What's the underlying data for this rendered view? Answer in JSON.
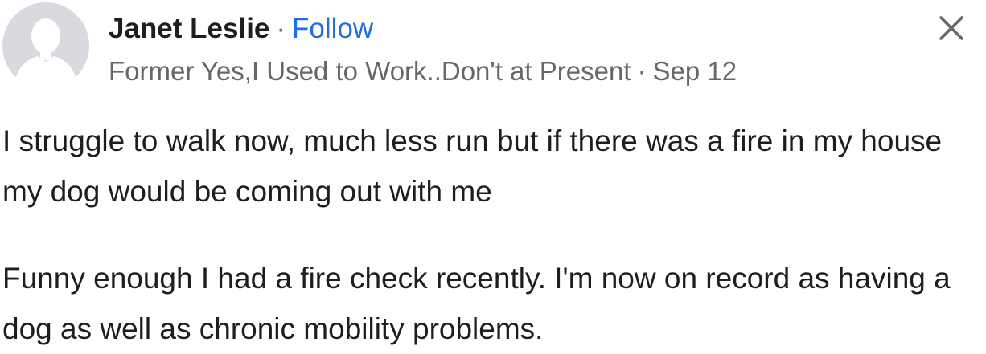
{
  "post": {
    "author": {
      "name": "Janet Leslie",
      "follow_label": "Follow",
      "name_separator": "·",
      "subtitle": "Former Yes,I Used to Work..Don't at Present",
      "meta_separator": "·",
      "date": "Sep 12"
    },
    "icons": {
      "avatar": "default-profile-silhouette",
      "close": "close-icon"
    },
    "paragraphs": [
      "I struggle to walk now, much less run but if there was a fire in my house my dog would be coming out with me",
      "Funny enough I had a fire check recently. I'm now on record as having a dog as well as chronic mobility problems."
    ],
    "colors": {
      "text": "#1c1e21",
      "secondary_text": "#65676b",
      "link": "#216fdb",
      "avatar_bg": "#d8dadf",
      "avatar_figure": "#ffffff"
    }
  }
}
